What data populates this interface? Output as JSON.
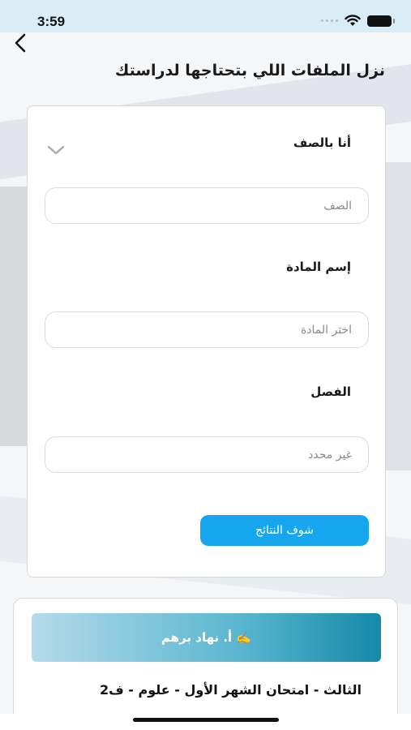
{
  "status_bar": {
    "time": "3:59"
  },
  "header": {
    "title": "نزل الملفات اللي بتحتاجها لدراستك"
  },
  "form": {
    "grade_label": "أنا بالصف",
    "grade_placeholder": "الصف",
    "subject_label": "إسم المادة",
    "subject_placeholder": "اختر المادة",
    "term_label": "الفصل",
    "term_placeholder": "غير محدد",
    "submit_label": "شوف النتائج"
  },
  "result": {
    "teacher": "✍️ أ. نهاد برهم",
    "title": "الثالث - امتحان الشهر الأول - علوم - ف2"
  },
  "colors": {
    "accent": "#16a6ee",
    "banner_start": "#b4dbe9",
    "banner_end": "#158aa7"
  },
  "icons": [
    "back-arrow-icon",
    "chevron-down-icon",
    "wifi-icon",
    "battery-icon"
  ]
}
